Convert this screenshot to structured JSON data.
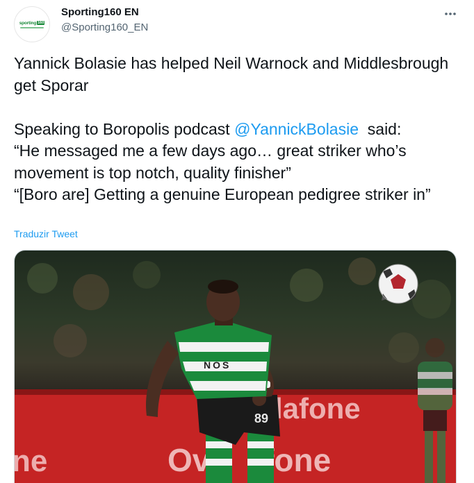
{
  "author": {
    "display_name": "Sporting160 EN",
    "handle": "@Sporting160_EN",
    "avatar_logo_text": "sporting",
    "avatar_logo_box": "160",
    "avatar_icon": "sporting160-logo"
  },
  "menu": {
    "icon": "more-horizontal-icon"
  },
  "tweet": {
    "text_part1": "Yannick Bolasie has helped Neil Warnock and Middlesbrough get Sporar\n\nSpeaking to Boropolis podcast ",
    "mention": "@YannickBolasie",
    "text_part2": "  said:\n“He messaged me a few days ago… great striker who’s movement is top notch, quality finisher”\n“[Boro are] Getting a genuine European pedigree striker in”"
  },
  "translate_label": "Traduzir Tweet",
  "media": {
    "shirt_sponsor": "NOS",
    "shirt_number": "89",
    "board_text_1": "dafone",
    "board_text_2": "Ove    fone",
    "board_text_3": "ne",
    "colors": {
      "board_red": "#c52424",
      "shirt_green": "#1b8a3c",
      "shirt_white": "#f2f2f2",
      "accent_blue": "#1d9bf0"
    }
  }
}
